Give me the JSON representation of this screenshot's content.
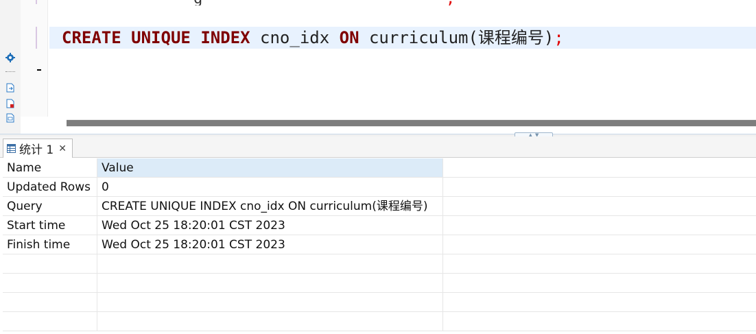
{
  "editor": {
    "code": {
      "kw_create": "CREATE",
      "kw_unique": "UNIQUE",
      "kw_index": "INDEX",
      "index_name": "cno_idx",
      "kw_on": "ON",
      "table_and_column": "curriculum(课程编号)",
      "terminator": ";"
    },
    "previous_line_fragment": "g",
    "previous_line_terminator": ";"
  },
  "colors": {
    "keyword": "#7f0000",
    "terminator": "#e00000",
    "current_line_highlight": "#e8f2fe",
    "header_value_highlight": "#dcebf8"
  },
  "ruler_icons": [
    "gear-icon",
    "export-file-icon",
    "error-file-icon",
    "xml-file-icon"
  ],
  "results": {
    "tab": {
      "icon": "grid-icon",
      "label": "统计 1",
      "close": "✕"
    },
    "columns": {
      "name": "Name",
      "value": "Value"
    },
    "rows": [
      {
        "name": "Updated Rows",
        "value": "0"
      },
      {
        "name": "Query",
        "value": "CREATE UNIQUE INDEX cno_idx ON curriculum(课程编号)"
      },
      {
        "name": "Start time",
        "value": "Wed Oct 25 18:20:01 CST 2023"
      },
      {
        "name": "Finish time",
        "value": "Wed Oct 25 18:20:01 CST 2023"
      }
    ]
  }
}
